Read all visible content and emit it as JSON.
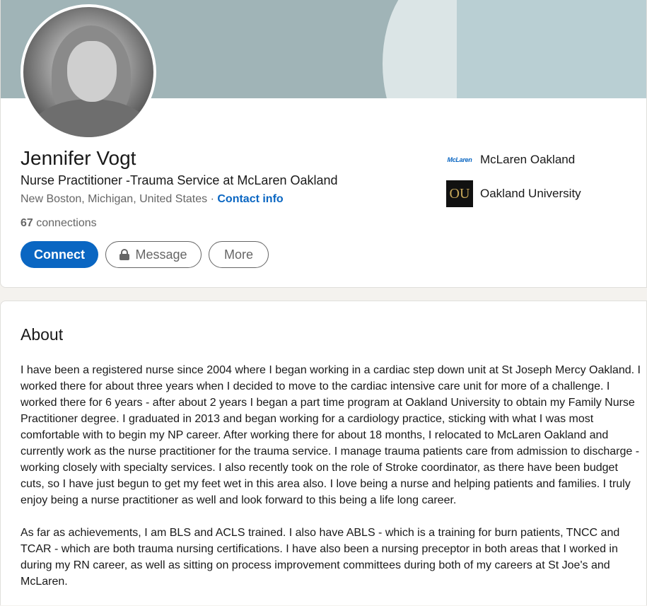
{
  "profile": {
    "name": "Jennifer Vogt",
    "headline": "Nurse Practitioner -Trauma Service at McLaren Oakland",
    "location": "New Boston, Michigan, United States",
    "separator": " · ",
    "contact_info_label": "Contact info",
    "connections_count": "67",
    "connections_label": "connections"
  },
  "actions": {
    "connect_label": "Connect",
    "message_label": "Message",
    "more_label": "More"
  },
  "organizations": [
    {
      "name": "McLaren Oakland",
      "logo_text": "McLaren",
      "icon": "mclaren-logo"
    },
    {
      "name": "Oakland University",
      "logo_text": "OU",
      "icon": "oakland-university-logo"
    }
  ],
  "about": {
    "title": "About",
    "paragraphs": [
      "I have been a registered nurse since 2004 where I began working in a cardiac step down unit at St Joseph Mercy Oakland. I worked there for about three years when I decided to move to the cardiac intensive care unit for more of a challenge. I worked there for 6 years - after about 2 years I began a part time program at Oakland University to obtain my Family Nurse Practitioner degree. I graduated in 2013 and began working for a cardiology practice, sticking with what I was most comfortable with to begin my NP career. After working there for about 18 months, I relocated to McLaren Oakland and currently work as the nurse practitioner for the trauma service. I manage trauma patients care from admission to discharge - working closely with specialty services. I also recently took on the role of Stroke coordinator, as there have been budget cuts, so I have just begun to get my feet wet in this area also. I love being a nurse and helping patients and families. I truly enjoy being a nurse practitioner as well and look forward to this being a life long career.",
      "As far as achievements, I am BLS and ACLS trained. I also have ABLS - which is a training for burn patients, TNCC and TCAR - which are both trauma nursing certifications. I have also been a nursing preceptor in both areas that I worked in during my RN career, as well as sitting on process improvement committees during both of my careers at St Joe's and McLaren."
    ]
  },
  "colors": {
    "accent": "#0a66c2",
    "banner": "#a0b4b7",
    "page_bg": "#f4f2ee"
  }
}
